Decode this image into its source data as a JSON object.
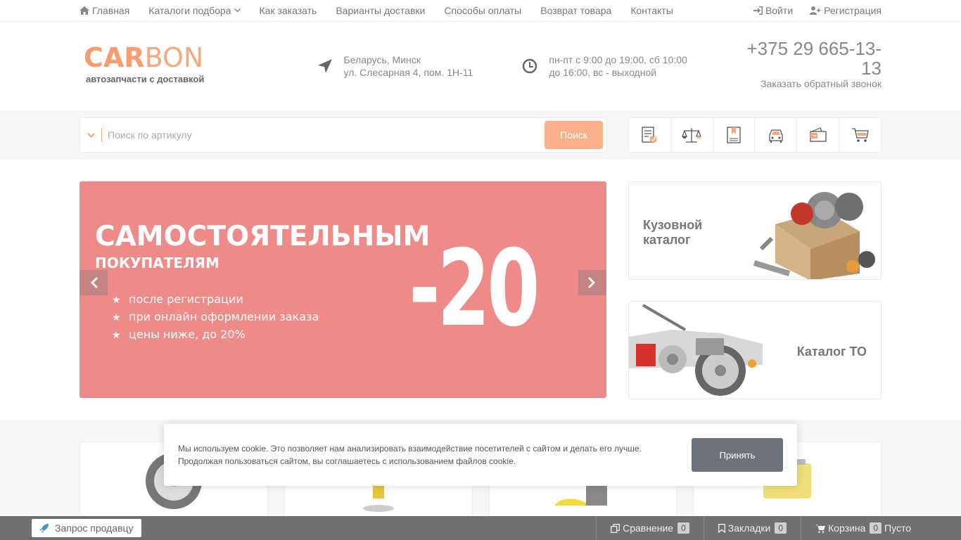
{
  "topnav": {
    "home": "Главная",
    "catalogs": "Каталоги подбора",
    "how_to_order": "Как заказать",
    "delivery": "Варианты доставки",
    "payment": "Способы оплаты",
    "returns": "Возврат товара",
    "contacts": "Контакты",
    "login": "Войти",
    "register": "Регистрация"
  },
  "logo": {
    "part1": "CAR",
    "part2": "BON",
    "tagline": "автозапчасти с доставкой"
  },
  "address": {
    "line1": "Беларусь, Минск",
    "line2": "ул. Слесарная 4, пом. 1Н-11"
  },
  "hours": {
    "line1": "пн-пт с 9:00 до 19:00, сб 10:00",
    "line2": "до 16:00, вс - выходной"
  },
  "contact": {
    "phone": "+375 29 665-13-13",
    "callback": "Заказать обратный звонок"
  },
  "search": {
    "placeholder": "Поиск по артикулу",
    "button": "Поиск"
  },
  "slider": {
    "title": "САМОСТОЯТЕЛЬНЫМ",
    "subtitle": "ПОКУПАТЕЛЯМ",
    "points": [
      "после регистрации",
      "при онлайн оформлении заказа",
      "цены ниже, до 20%"
    ],
    "discount": "-20",
    "bg_color": "#ee8b89"
  },
  "side_cards": {
    "body": "Кузовной\nкаталог",
    "to": "Каталог ТО"
  },
  "cookie": {
    "text1": "Мы используем cookie. Это позволяет нам анализировать взаимодействие посетителей с сайтом и делать его лучше.",
    "text2": "Продолжая пользоваться сайтом, вы соглашаетесь с использованием файлов cookie.",
    "accept": "Принять"
  },
  "bottombar": {
    "request": "Запрос продавцу",
    "compare": "Сравнение",
    "compare_count": "0",
    "bookmarks": "Закладки",
    "bookmarks_count": "0",
    "cart": "Корзина",
    "cart_count": "0",
    "cart_status": "Пусто"
  },
  "colors": {
    "accent": "#f5a87e",
    "bottombar": "#707070"
  }
}
